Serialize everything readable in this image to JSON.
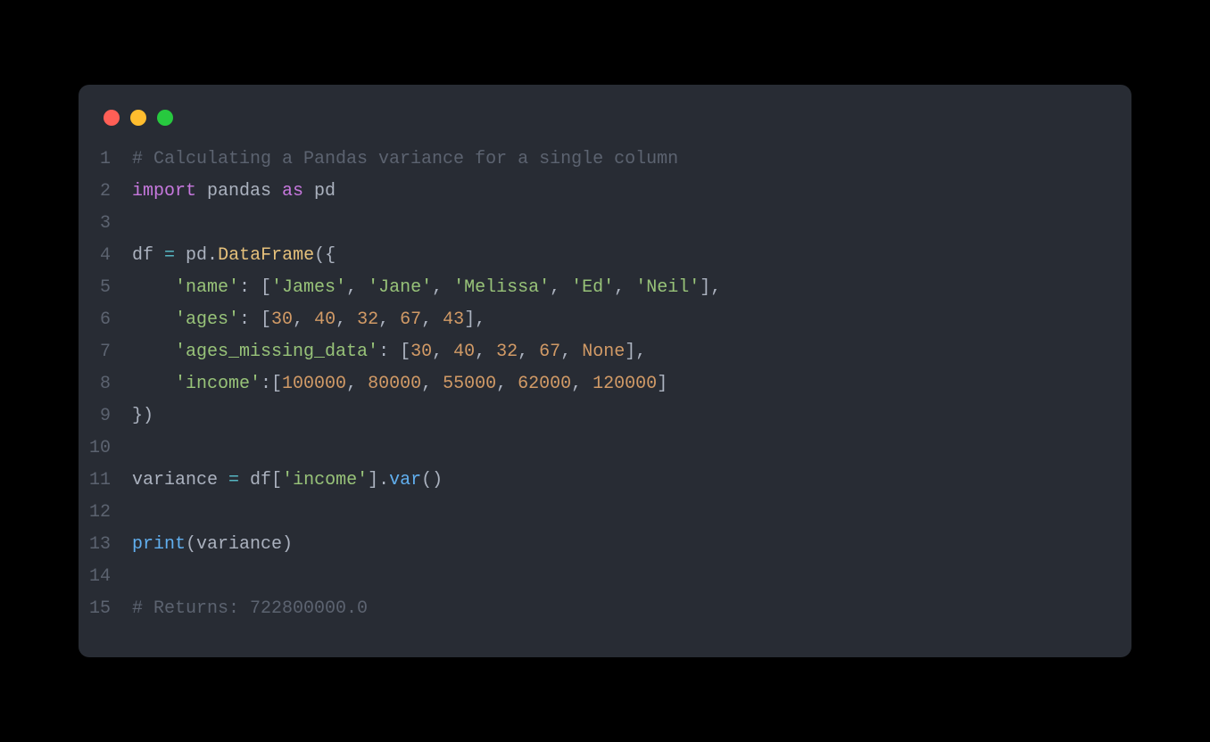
{
  "titlebar": {
    "close": "close",
    "minimize": "minimize",
    "maximize": "maximize"
  },
  "lines": {
    "n1": "1",
    "n2": "2",
    "n3": "3",
    "n4": "4",
    "n5": "5",
    "n6": "6",
    "n7": "7",
    "n8": "8",
    "n9": "9",
    "n10": "10",
    "n11": "11",
    "n12": "12",
    "n13": "13",
    "n14": "14",
    "n15": "15"
  },
  "code": {
    "l1": {
      "comment": "# Calculating a Pandas variance for a single column"
    },
    "l2": {
      "import": "import",
      "pandas": " pandas ",
      "as": "as",
      "pd": " pd"
    },
    "l4": {
      "df": "df ",
      "eq": "=",
      "pd": " pd",
      "dot": ".",
      "DataFrame": "DataFrame",
      "open": "({"
    },
    "l5": {
      "indent": "    ",
      "key": "'name'",
      "colon": ": [",
      "v1": "'James'",
      "c1": ", ",
      "v2": "'Jane'",
      "c2": ", ",
      "v3": "'Melissa'",
      "c3": ", ",
      "v4": "'Ed'",
      "c4": ", ",
      "v5": "'Neil'",
      "end": "],"
    },
    "l6": {
      "indent": "    ",
      "key": "'ages'",
      "colon": ": [",
      "v1": "30",
      "c1": ", ",
      "v2": "40",
      "c2": ", ",
      "v3": "32",
      "c3": ", ",
      "v4": "67",
      "c4": ", ",
      "v5": "43",
      "end": "],"
    },
    "l7": {
      "indent": "    ",
      "key": "'ages_missing_data'",
      "colon": ": [",
      "v1": "30",
      "c1": ", ",
      "v2": "40",
      "c2": ", ",
      "v3": "32",
      "c3": ", ",
      "v4": "67",
      "c4": ", ",
      "v5": "None",
      "end": "],"
    },
    "l8": {
      "indent": "    ",
      "key": "'income'",
      "colon": ":[",
      "v1": "100000",
      "c1": ", ",
      "v2": "80000",
      "c2": ", ",
      "v3": "55000",
      "c3": ", ",
      "v4": "62000",
      "c4": ", ",
      "v5": "120000",
      "end": "]"
    },
    "l9": {
      "close": "})"
    },
    "l11": {
      "var": "variance ",
      "eq": "=",
      "sp": " df[",
      "key": "'income'",
      "mid": "].",
      "fn": "var",
      "end": "()"
    },
    "l13": {
      "print": "print",
      "open": "(variance)"
    },
    "l15": {
      "comment": "# Returns: 722800000.0"
    }
  }
}
